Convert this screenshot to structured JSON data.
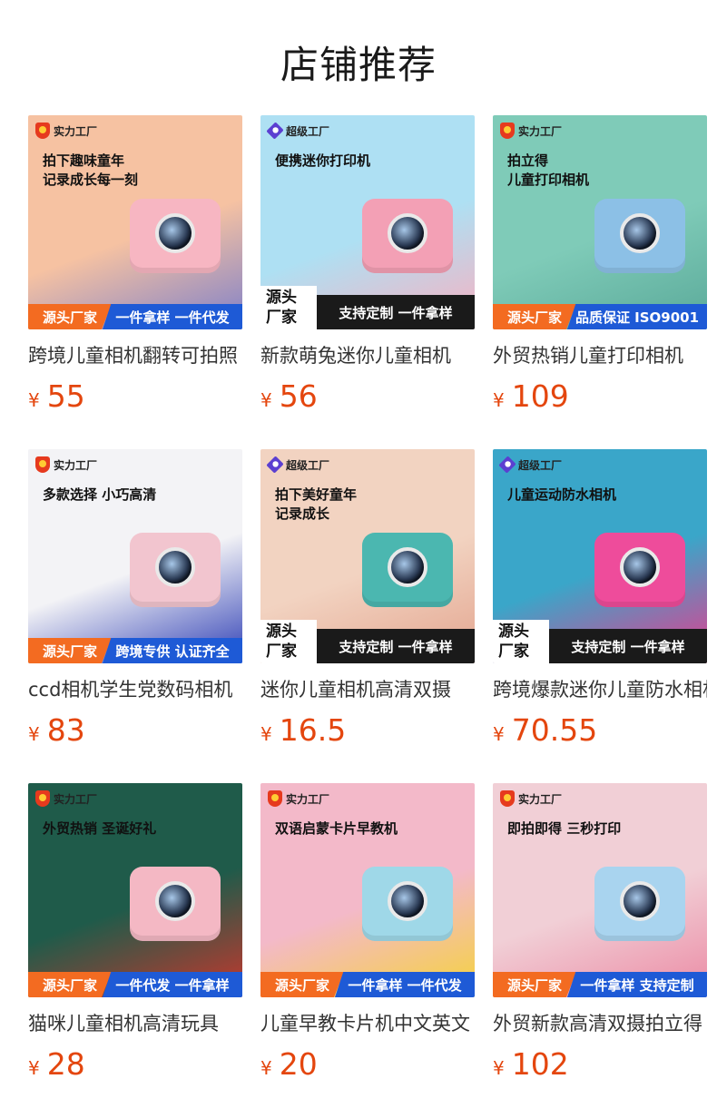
{
  "page": {
    "title": "店铺推荐"
  },
  "products": [
    {
      "brand": "实力工厂",
      "brand_type": "factory",
      "headline": "拍下趣味童年\n记录成长每一刻",
      "strip_type": "a",
      "strip_left": "源头厂家",
      "strip_right": "一件拿样 一件代发",
      "title": "跨境儿童相机翻转可拍照",
      "currency": "¥",
      "price": "55",
      "bg": "#f6c2a2",
      "accent": "#7d7fc9",
      "cam_color": "#f7b6c2"
    },
    {
      "brand": "超级工厂",
      "brand_type": "super",
      "headline": "便携迷你打印机",
      "strip_type": "b",
      "strip_left": "源头\n厂家",
      "strip_right": "支持定制 一件拿样",
      "title": "新款萌兔迷你儿童相机",
      "currency": "¥",
      "price": "56",
      "bg": "#aee0f3",
      "accent": "#f9b0c0",
      "cam_color": "#f3a0b5"
    },
    {
      "brand": "实力工厂",
      "brand_type": "factory",
      "headline": "拍立得\n儿童打印相机",
      "strip_type": "a",
      "strip_left": "源头厂家",
      "strip_right": "品质保证 ISO9001",
      "title": "外贸热销儿童打印相机",
      "currency": "¥",
      "price": "109",
      "bg": "#7fcbb8",
      "accent": "#5aa999",
      "cam_color": "#8cc0e6"
    },
    {
      "brand": "实力工厂",
      "brand_type": "factory",
      "headline": "多款选择 小巧高清",
      "strip_type": "a",
      "strip_left": "源头厂家",
      "strip_right": "跨境专供 认证齐全",
      "title": "ccd相机学生党数码相机",
      "currency": "¥",
      "price": "83",
      "bg": "#f3f3f6",
      "accent": "#2f3fb5",
      "cam_color": "#f2c5cf"
    },
    {
      "brand": "超级工厂",
      "brand_type": "super",
      "headline": "拍下美好童年\n记录成长",
      "strip_type": "b",
      "strip_left": "源头\n厂家",
      "strip_right": "支持定制 一件拿样",
      "title": "迷你儿童相机高清双摄",
      "currency": "¥",
      "price": "16.5",
      "bg": "#f2d3c1",
      "accent": "#e3a58f",
      "cam_color": "#4bb7b0"
    },
    {
      "brand": "超级工厂",
      "brand_type": "super",
      "headline": "儿童运动防水相机",
      "strip_type": "b",
      "strip_left": "源头\n厂家",
      "strip_right": "支持定制 一件拿样",
      "title": "跨境爆款迷你儿童防水相机",
      "currency": "¥",
      "price": "70.55",
      "bg": "#3aa6c9",
      "accent": "#e83b8d",
      "cam_color": "#ee4c9b"
    },
    {
      "brand": "实力工厂",
      "brand_type": "factory",
      "headline": "外贸热销 圣诞好礼",
      "strip_type": "a",
      "strip_left": "源头厂家",
      "strip_right": "一件代发 一件拿样",
      "title": "猫咪儿童相机高清玩具",
      "currency": "¥",
      "price": "28",
      "bg": "#1f5b4a",
      "accent": "#c8372d",
      "cam_color": "#f4b8c4"
    },
    {
      "brand": "实力工厂",
      "brand_type": "factory",
      "headline": "双语启蒙卡片早教机",
      "strip_type": "a",
      "strip_left": "源头厂家",
      "strip_right": "一件拿样 一件代发",
      "title": "儿童早教卡片机中文英文",
      "currency": "¥",
      "price": "20",
      "bg": "#f3b9c9",
      "accent": "#f5d33a",
      "cam_color": "#9fd8e8"
    },
    {
      "brand": "实力工厂",
      "brand_type": "factory",
      "headline": "即拍即得 三秒打印",
      "strip_type": "a",
      "strip_left": "源头厂家",
      "strip_right": "一件拿样 支持定制",
      "title": "外贸新款高清双摄拍立得",
      "currency": "¥",
      "price": "102",
      "bg": "#f1cfd6",
      "accent": "#eb8aa4",
      "cam_color": "#a9d4ef"
    }
  ]
}
